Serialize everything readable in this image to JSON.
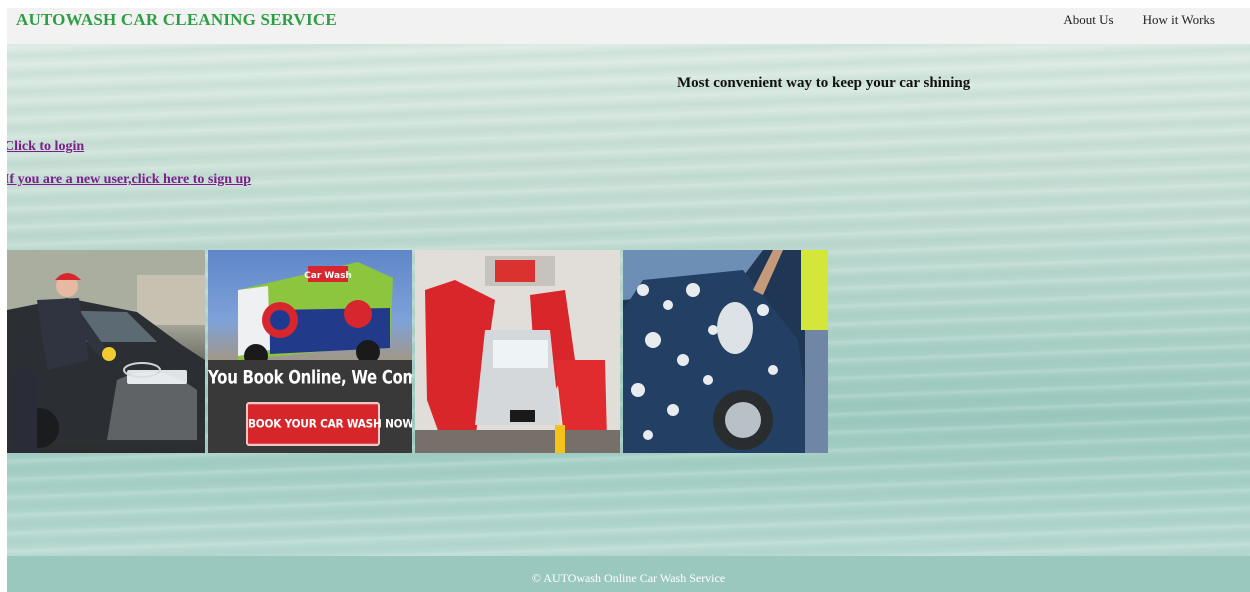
{
  "header": {
    "brand": "AUTOWASH CAR CLEANING SERVICE",
    "nav": [
      {
        "label": "About Us"
      },
      {
        "label": "How it Works"
      }
    ]
  },
  "hero": {
    "tagline": "Most convenient way to keep your car shining",
    "login_link": "Click to login",
    "signup_link": "If you are a new user,click here to sign up"
  },
  "gallery": {
    "banner_text": "You Book Online, We Come to You",
    "banner_button": "BOOK YOUR CAR WASH NOW",
    "van_brand": "Car Wash"
  },
  "footer": {
    "copyright": "© AUTOwash Online Car Wash Service"
  },
  "colors": {
    "brand": "#2e9e45",
    "link": "#7a1e8a",
    "footer": "#9bc8be",
    "navbar": "#f2f2f2"
  }
}
